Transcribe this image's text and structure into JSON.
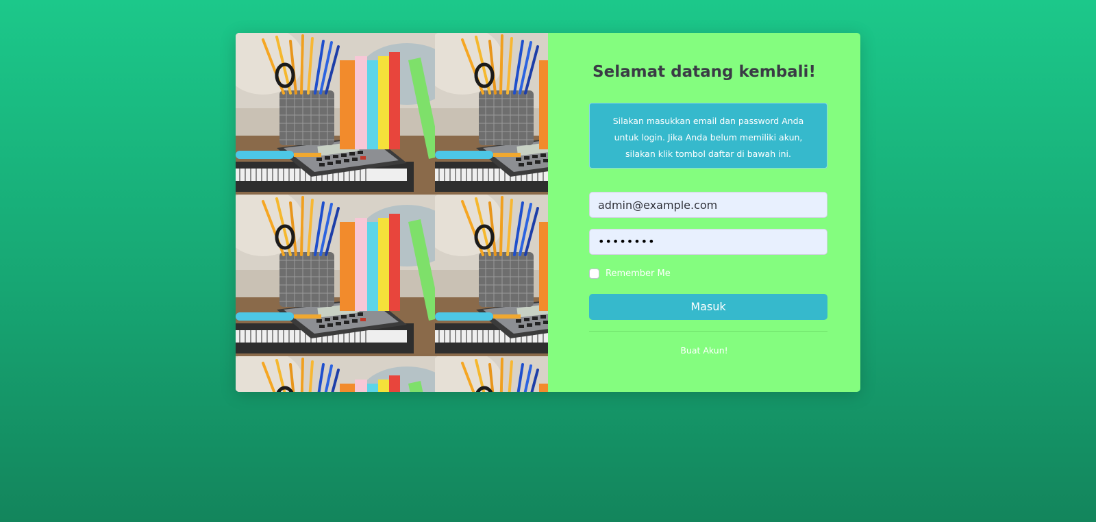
{
  "page": {
    "background_colors": [
      "#1cc88a",
      "#13855c"
    ]
  },
  "image_pane": {
    "picture": "school-supplies-photo",
    "description_icon": "pencils-books-calculator"
  },
  "form": {
    "title": "Selamat datang kembali!",
    "info_text": "Silakan masukkan email dan password Anda untuk login. Jika Anda belum memiliki akun, silakan klik tombol daftar di bawah ini.",
    "email_value": "admin@example.com",
    "password_mask": "••••••••",
    "remember_label": "Remember Me",
    "remember_checked": false,
    "login_label": "Masuk",
    "register_label": "Buat Akun!",
    "colors": {
      "pane": "#84fd7f",
      "accent": "#36b9cc",
      "title": "#3a3b45",
      "input_bg": "#e8f0fe"
    }
  }
}
